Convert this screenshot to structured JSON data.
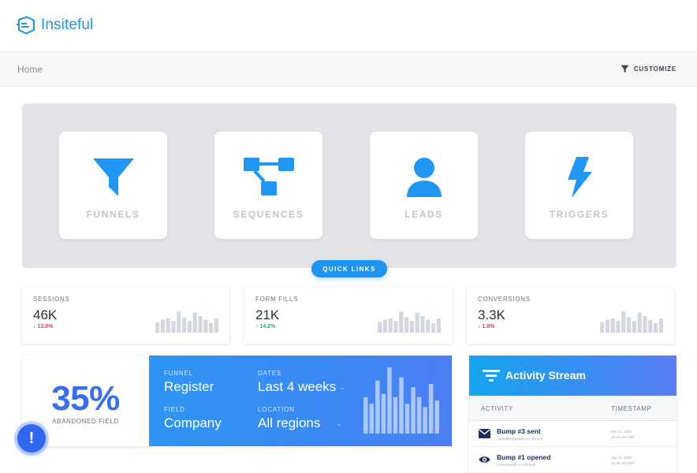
{
  "app": {
    "name": "Insiteful",
    "brand_color": "#1f93e6"
  },
  "breadcrumb": {
    "current": "Home"
  },
  "toolbar": {
    "customize_label": "CUSTOMIZE",
    "customize_icon": "filter-icon"
  },
  "quick_links": {
    "pill_label": "QUICK LINKS",
    "tiles": [
      {
        "label": "FUNNELS",
        "icon": "funnel-icon"
      },
      {
        "label": "SEQUENCES",
        "icon": "sequence-icon"
      },
      {
        "label": "LEADS",
        "icon": "person-icon"
      },
      {
        "label": "TRIGGERS",
        "icon": "lightning-icon"
      }
    ]
  },
  "metrics": [
    {
      "label": "SESSIONS",
      "value": "46K",
      "delta": "13.8%",
      "trend": "down",
      "bars": [
        0.45,
        0.55,
        0.6,
        0.5,
        0.9,
        0.65,
        0.5,
        0.85,
        0.7,
        0.55,
        0.4,
        0.6
      ]
    },
    {
      "label": "FORM FILLS",
      "value": "21K",
      "delta": "14.2%",
      "trend": "up",
      "bars": [
        0.45,
        0.55,
        0.6,
        0.5,
        0.9,
        0.65,
        0.5,
        0.85,
        0.7,
        0.55,
        0.4,
        0.6
      ]
    },
    {
      "label": "CONVERSIONS",
      "value": "3.3K",
      "delta": "1.8%",
      "trend": "down",
      "bars": [
        0.45,
        0.55,
        0.6,
        0.5,
        0.9,
        0.65,
        0.5,
        0.85,
        0.7,
        0.55,
        0.4,
        0.6
      ]
    }
  ],
  "funnel": {
    "abandon_pct": "35%",
    "abandon_label": "ABANDONED FIELD",
    "fields": [
      {
        "label": "FUNNEL",
        "value": "Register"
      },
      {
        "label": "DATES",
        "value": "Last 4 weeks"
      },
      {
        "label": "FIELD",
        "value": "Company"
      },
      {
        "label": "LOCATION",
        "value": "All regions"
      }
    ],
    "bars": [
      0.55,
      0.45,
      0.8,
      0.6,
      1.0,
      0.55,
      0.85,
      0.45,
      0.7,
      0.55,
      0.4,
      0.75,
      0.5
    ]
  },
  "activity": {
    "title": "Activity Stream",
    "columns": [
      "ACTIVITY",
      "TIMESTAMP"
    ],
    "rows": [
      {
        "icon": "envelope-icon",
        "title": "Bump #3 sent",
        "sub": "_ariedike@gmail.co • Default",
        "time1": "Jan 12, 2020",
        "time2": "10:25 AM GMT"
      },
      {
        "icon": "eye-icon",
        "title": "Bump #1 opened",
        "sub": "ychun@mail.co • Default",
        "time1": "Jan 12, 2020",
        "time2": "10:25 AM GMT"
      }
    ]
  },
  "alert": {
    "symbol": "!"
  }
}
